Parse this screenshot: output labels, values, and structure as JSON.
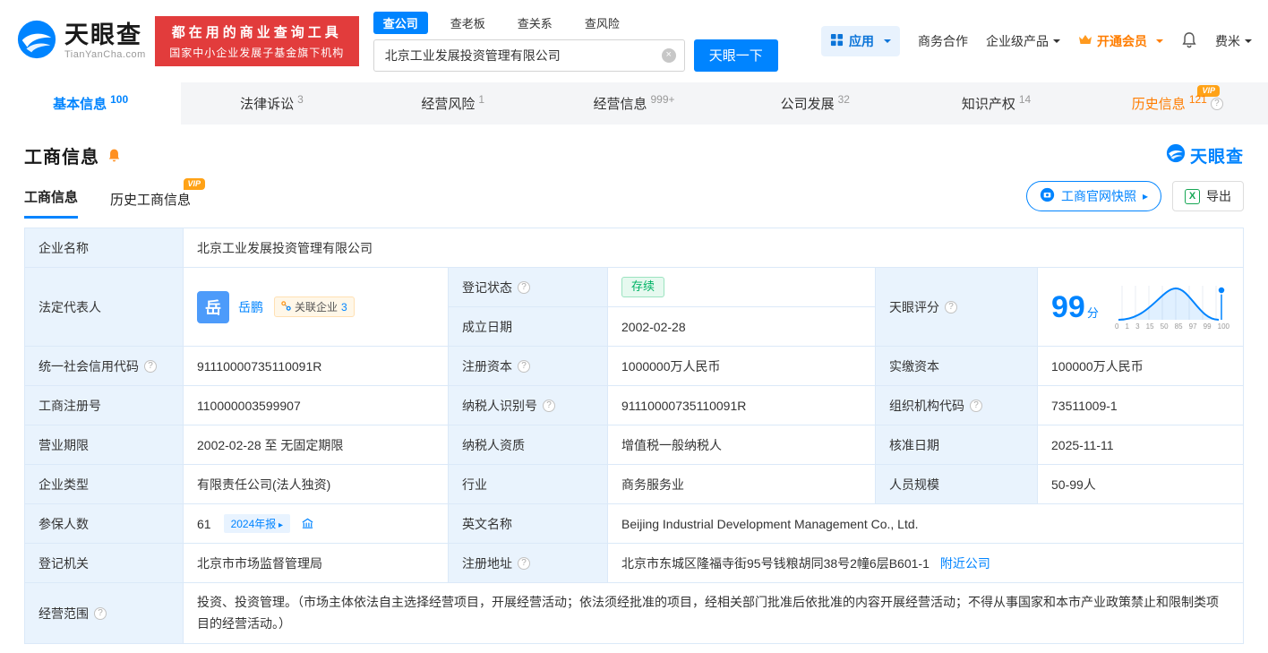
{
  "brand": {
    "name": "天眼查",
    "domain": "TianYanCha.com",
    "accent": "#0084ff"
  },
  "header": {
    "slogan_line1": "都在用的商业查询工具",
    "slogan_line2": "国家中小企业发展子基金旗下机构",
    "search_tabs": [
      {
        "label": "查公司",
        "active": true
      },
      {
        "label": "查老板",
        "active": false
      },
      {
        "label": "查关系",
        "active": false
      },
      {
        "label": "查风险",
        "active": false
      }
    ],
    "search_value": "北京工业发展投资管理有限公司",
    "search_button": "天眼一下",
    "apps_label": "应用",
    "link_cooperation": "商务合作",
    "link_enterprise": "企业级产品",
    "link_vip": "开通会员",
    "link_user": "费米"
  },
  "nav_tabs": [
    {
      "label": "基本信息",
      "count": "100"
    },
    {
      "label": "法律诉讼",
      "count": "3"
    },
    {
      "label": "经营风险",
      "count": "1"
    },
    {
      "label": "经营信息",
      "count": "999+"
    },
    {
      "label": "公司发展",
      "count": "32"
    },
    {
      "label": "知识产权",
      "count": "14"
    },
    {
      "label": "历史信息",
      "count": "121"
    }
  ],
  "section": {
    "title": "工商信息",
    "logo_text": "天眼查",
    "vip": "VIP",
    "subtab_current": "工商信息",
    "subtab_history": "历史工商信息",
    "snapshot_button": "工商官网快照",
    "export_button": "导出"
  },
  "table": {
    "labels": {
      "company_name": "企业名称",
      "legal_rep": "法定代表人",
      "reg_status": "登记状态",
      "establish_date": "成立日期",
      "score": "天眼评分",
      "credit_code": "统一社会信用代码",
      "reg_capital": "注册资本",
      "paid_capital": "实缴资本",
      "reg_number": "工商注册号",
      "taxpayer_id": "纳税人识别号",
      "org_code": "组织机构代码",
      "business_term": "营业期限",
      "taxpayer_quality": "纳税人资质",
      "approval_date": "核准日期",
      "company_type": "企业类型",
      "industry": "行业",
      "staff_size": "人员规模",
      "insured_count": "参保人数",
      "english_name": "英文名称",
      "reg_authority": "登记机关",
      "reg_address": "注册地址",
      "business_scope": "经营范围"
    },
    "values": {
      "company_name": "北京工业发展投资管理有限公司",
      "legal_rep_avatar": "岳",
      "legal_rep_name": "岳鹏",
      "related_label": "关联企业",
      "related_count": "3",
      "reg_status": "存续",
      "establish_date": "2002-02-28",
      "score": "99",
      "score_unit": "分",
      "score_axis": [
        "0",
        "1",
        "3",
        "15",
        "50",
        "85",
        "97",
        "99",
        "100"
      ],
      "credit_code": "91110000735110091R",
      "reg_capital": "1000000万人民币",
      "paid_capital": "100000万人民币",
      "reg_number": "110000003599907",
      "taxpayer_id": "91110000735110091R",
      "org_code": "73511009-1",
      "business_term": "2002-02-28 至 无固定期限",
      "taxpayer_quality": "增值税一般纳税人",
      "approval_date": "2025-11-11",
      "company_type": "有限责任公司(法人独资)",
      "industry": "商务服务业",
      "staff_size": "50-99人",
      "insured_count": "61",
      "annual_report_badge": "2024年报",
      "english_name": "Beijing Industrial Development Management Co., Ltd.",
      "reg_authority": "北京市市场监督管理局",
      "reg_address": "北京市东城区隆福寺街95号钱粮胡同38号2幢6层B601-1",
      "nearby_link": "附近公司",
      "business_scope": "投资、投资管理。（市场主体依法自主选择经营项目，开展经营活动；依法须经批准的项目，经相关部门批准后依批准的内容开展经营活动；不得从事国家和本市产业政策禁止和限制类项目的经营活动。）"
    }
  }
}
